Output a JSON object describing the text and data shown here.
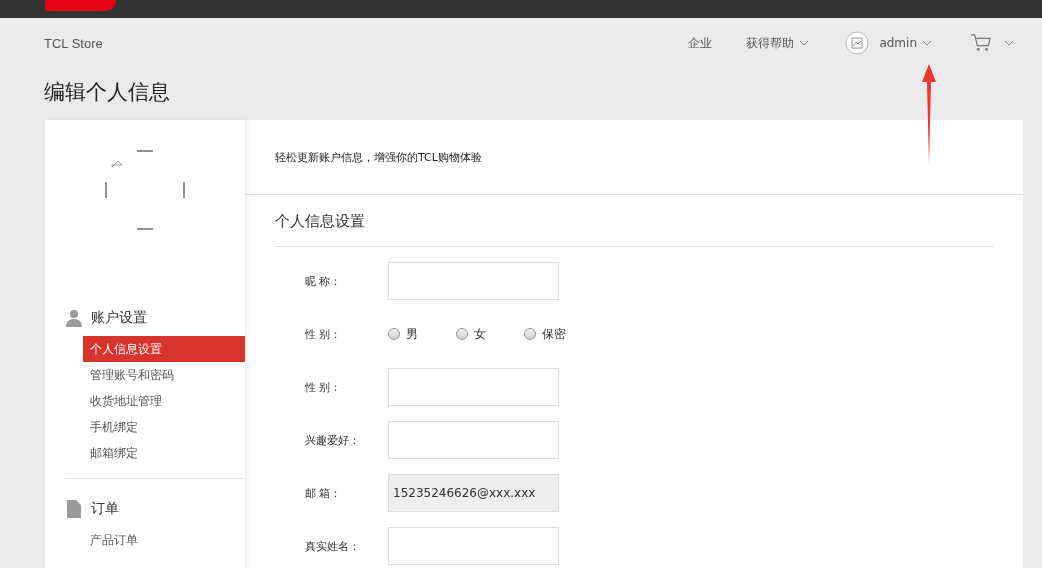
{
  "header": {
    "brand": "TCL Store",
    "nav": [
      {
        "label": "企业",
        "dropdown": false
      },
      {
        "label": "获得帮助",
        "dropdown": true
      }
    ],
    "user": {
      "name": "admin"
    }
  },
  "page_title": "编辑个人信息",
  "sidebar": {
    "groups": [
      {
        "title": "账户设置",
        "kind": "user",
        "items": [
          {
            "label": "个人信息设置",
            "selected": true
          },
          {
            "label": "管理账号和密码",
            "selected": false
          },
          {
            "label": "收货地址管理",
            "selected": false
          },
          {
            "label": "手机绑定",
            "selected": false
          },
          {
            "label": "邮箱绑定",
            "selected": false
          }
        ]
      },
      {
        "title": "订单",
        "kind": "document",
        "items": [
          {
            "label": "产品订单",
            "selected": false
          }
        ]
      }
    ]
  },
  "intro": "轻松更新账户信息，增强你的TCL购物体验",
  "section_title": "个人信息设置",
  "form": [
    {
      "kind": "text",
      "label": "昵 称：",
      "disabled": false
    },
    {
      "kind": "radio",
      "label": "性 别：",
      "options": [
        {
          "label": "男",
          "selected": false
        },
        {
          "label": "女",
          "selected": false
        },
        {
          "label": "保密",
          "selected": false
        }
      ]
    },
    {
      "kind": "text",
      "label": "性 别：",
      "disabled": false
    },
    {
      "kind": "text",
      "label": "兴趣爱好：",
      "disabled": false
    },
    {
      "kind": "text",
      "label": "邮 箱：",
      "value": "15235246626@xxx.xxx",
      "disabled": true
    },
    {
      "kind": "text",
      "label": "真实姓名：",
      "disabled": false
    }
  ]
}
